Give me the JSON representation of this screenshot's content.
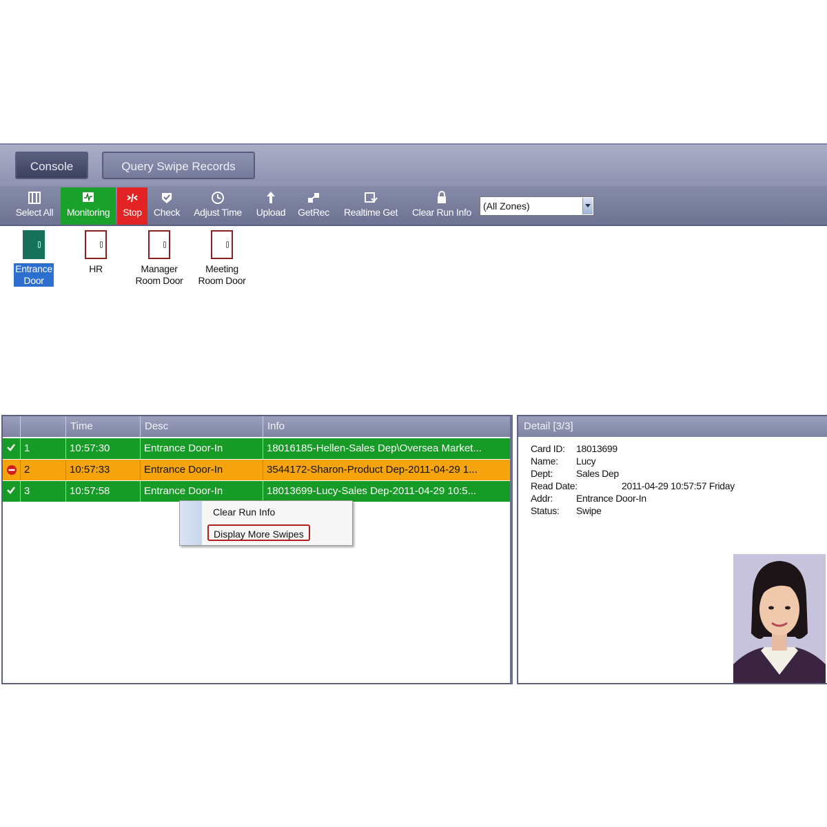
{
  "tabs": {
    "console": "Console",
    "query": "Query Swipe Records"
  },
  "toolbar": {
    "select_all": "Select All",
    "monitoring": "Monitoring",
    "stop": "Stop",
    "check": "Check",
    "adjust_time": "Adjust Time",
    "upload": "Upload",
    "getrec": "GetRec",
    "realtime_get": "Realtime Get",
    "clear_run_info": "Clear Run Info",
    "zone_select": "(All Zones)"
  },
  "doors": [
    {
      "line1": "Entrance",
      "line2": "Door"
    },
    {
      "line1": "HR",
      "line2": ""
    },
    {
      "line1": "Manager",
      "line2": "Room Door"
    },
    {
      "line1": "Meeting",
      "line2": "Room Door"
    }
  ],
  "grid": {
    "headers": [
      "",
      "",
      "Time",
      "Desc",
      "Info"
    ],
    "rows": [
      {
        "status": "ok",
        "num": "1",
        "time": "10:57:30",
        "desc": "Entrance Door-In",
        "info": "18016185-Hellen-Sales Dep\\Oversea Market..."
      },
      {
        "status": "err",
        "num": "2",
        "time": "10:57:33",
        "desc": "Entrance Door-In",
        "info": "3544172-Sharon-Product Dep-2011-04-29 1..."
      },
      {
        "status": "ok",
        "num": "3",
        "time": "10:57:58",
        "desc": "Entrance Door-In",
        "info": "18013699-Lucy-Sales Dep-2011-04-29 10:5..."
      }
    ]
  },
  "context_menu": {
    "clear": "Clear Run Info",
    "display_more": "Display More Swipes"
  },
  "detail": {
    "title": "Detail  [3/3]",
    "fields": [
      {
        "k": "Card ID:",
        "v": "18013699"
      },
      {
        "k": "Name:",
        "v": "Lucy"
      },
      {
        "k": "Dept:",
        "v": "Sales Dep"
      },
      {
        "k": "Read Date:",
        "v": "2011-04-29 10:57:57 Friday"
      },
      {
        "k": "Addr:",
        "v": "Entrance Door-In"
      },
      {
        "k": "Status:",
        "v": "Swipe"
      }
    ]
  },
  "colors": {
    "ok_row": "#169c26",
    "err_row": "#f5a40e",
    "stop": "#e42424",
    "monitoring": "#1aa22c"
  }
}
